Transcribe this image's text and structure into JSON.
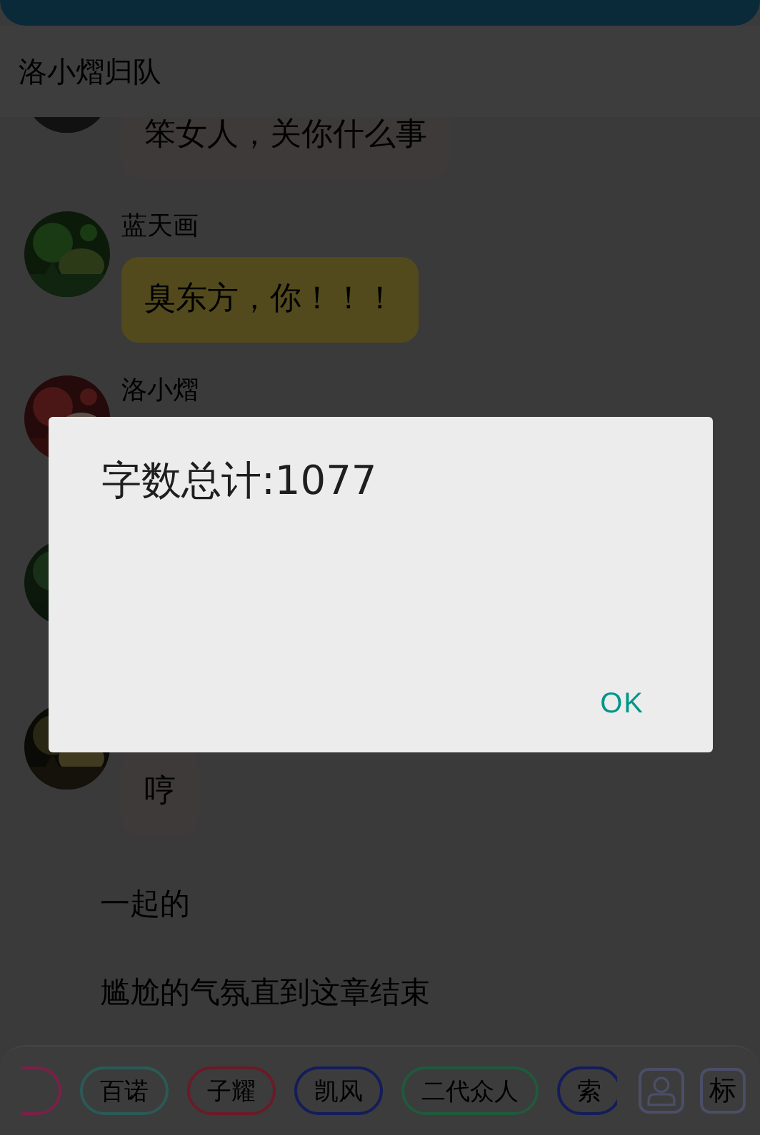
{
  "header": {
    "title": "洛小熠归队"
  },
  "messages": [
    {
      "kind": "chat",
      "text": "笨女人，关你什么事",
      "color": "#3f3a3a"
    },
    {
      "kind": "chat",
      "name": "蓝天画",
      "text": "臭东方，你！！！",
      "color": "#524a1c"
    },
    {
      "kind": "chat",
      "name": "洛小熠"
    },
    {
      "kind": "chat"
    },
    {
      "kind": "chat",
      "text": "哼",
      "color": "#3f3a3a"
    },
    {
      "kind": "narration",
      "text": "一起的"
    },
    {
      "kind": "narration",
      "text": "尴尬的气氛直到这章结束"
    }
  ],
  "tags": [
    {
      "color": "#7a2048"
    },
    {
      "label": "百诺",
      "color": "#2a5a55"
    },
    {
      "label": "子耀",
      "color": "#6a1a28"
    },
    {
      "label": "凯风",
      "color": "#141c5a"
    },
    {
      "label": "二代众人",
      "color": "#1f5a3c"
    },
    {
      "label": "索",
      "color": "#141c5a"
    }
  ],
  "actions": [
    {
      "kind": "person"
    },
    {
      "kind": "text",
      "label": "标"
    }
  ],
  "dialog": {
    "message": "字数总计:1077",
    "button": "OK"
  }
}
